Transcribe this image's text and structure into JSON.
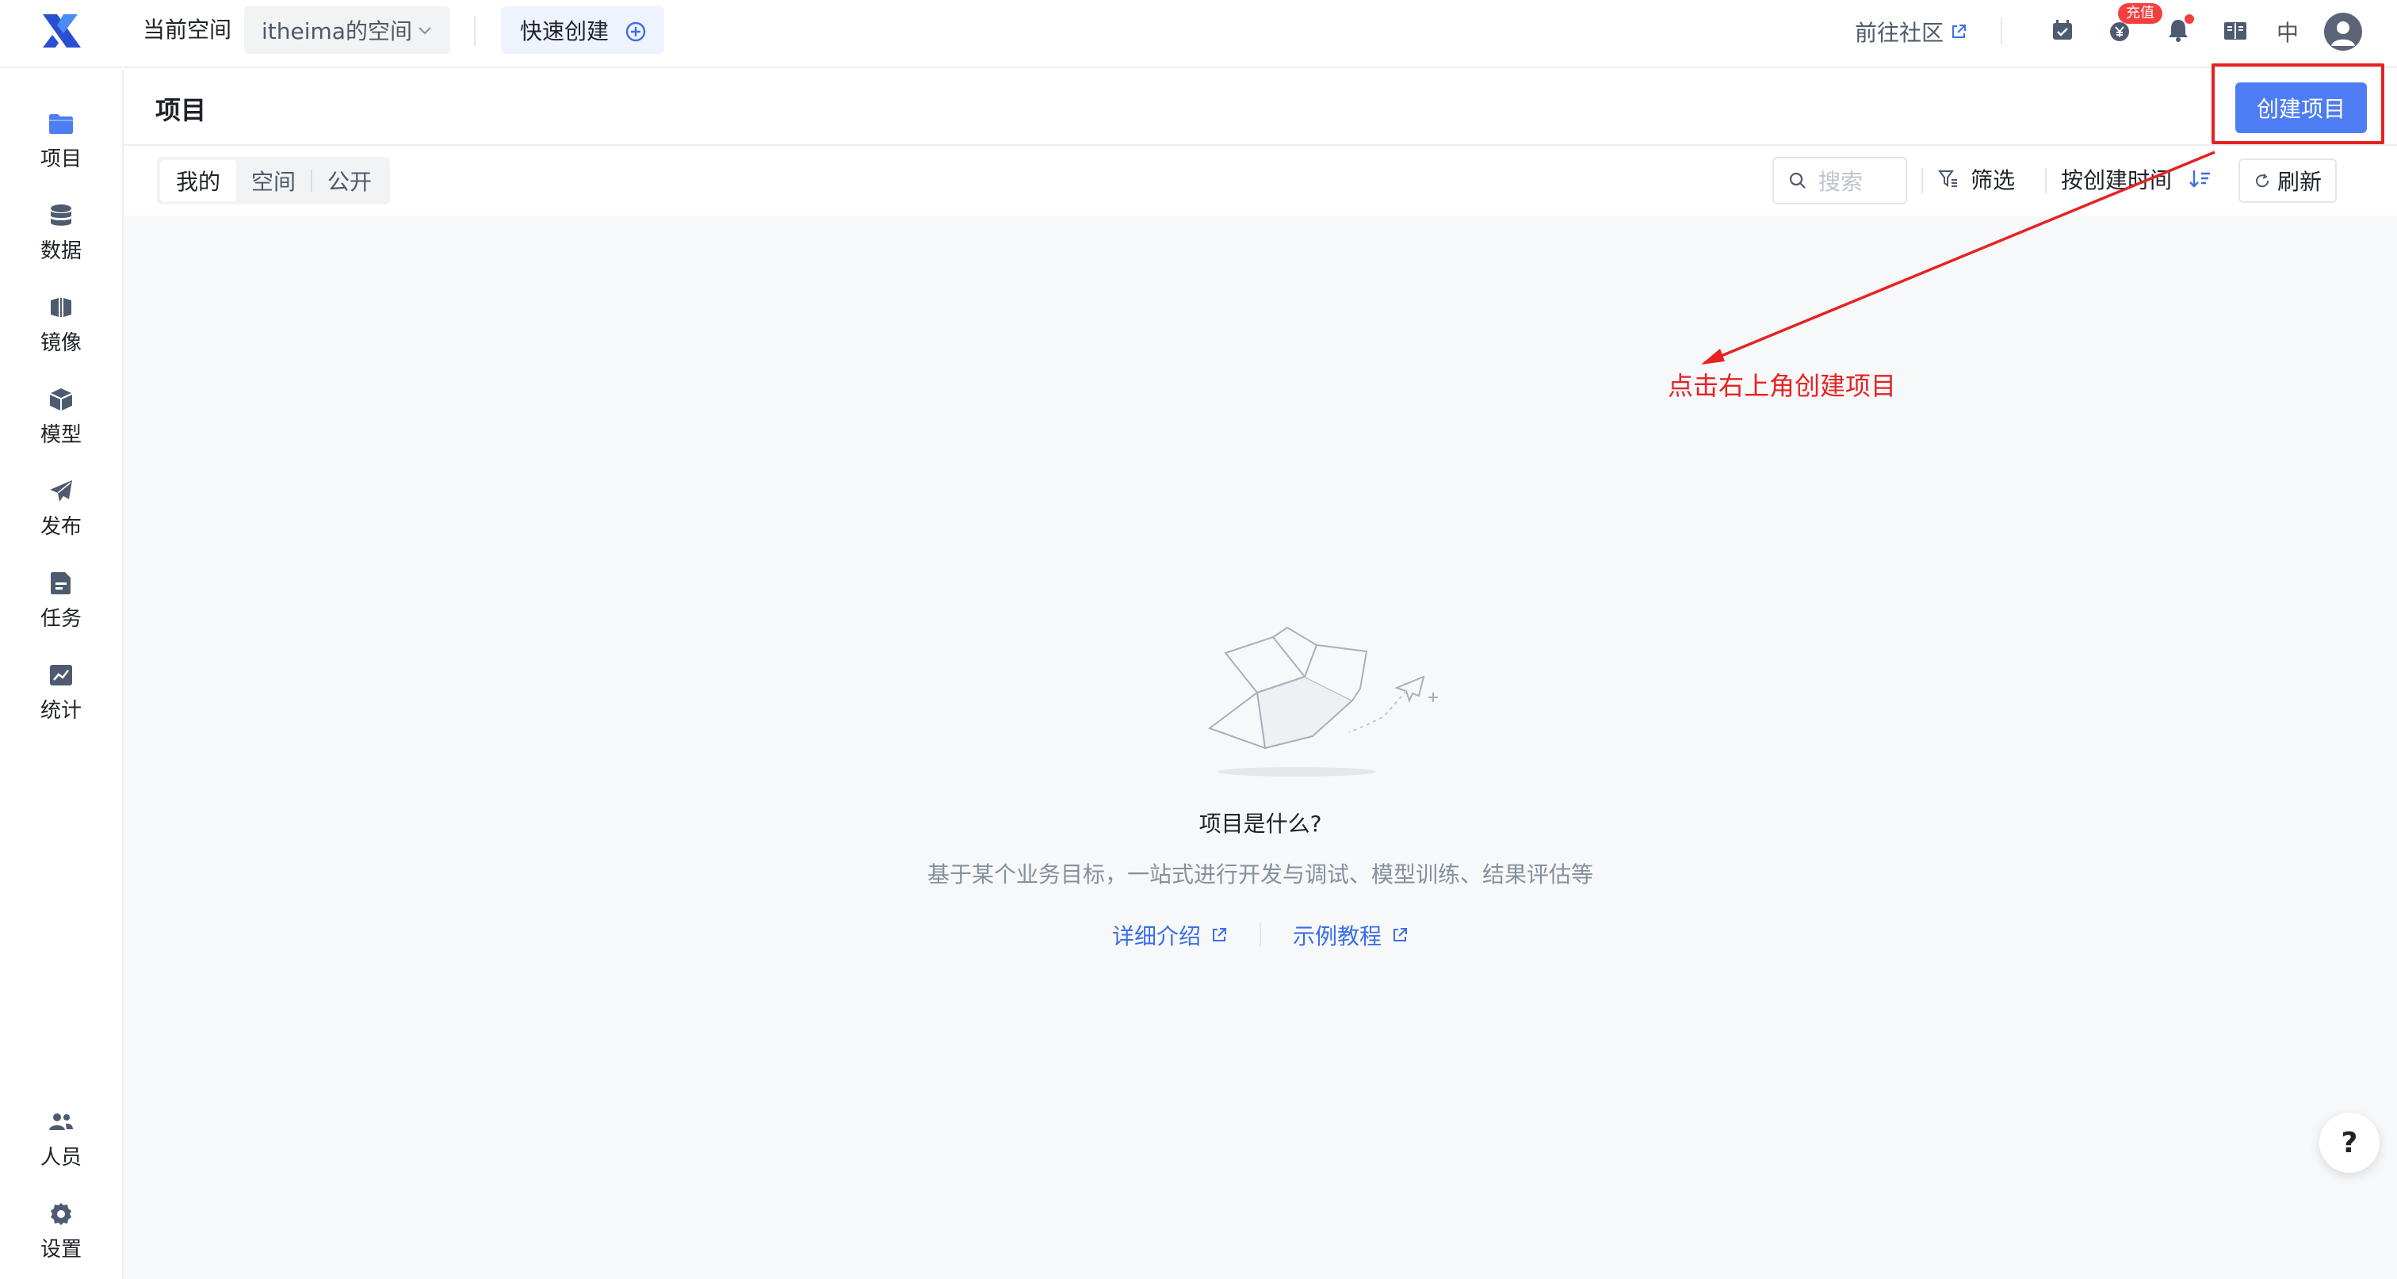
{
  "topbar": {
    "space_label": "当前空间",
    "space_value": "itheima的空间",
    "quick_create": "快速创建",
    "community": "前往社区",
    "recharge_badge": "充值",
    "lang": "中"
  },
  "sidebar": {
    "items": [
      {
        "label": "项目",
        "icon": "folder-icon"
      },
      {
        "label": "数据",
        "icon": "database-icon"
      },
      {
        "label": "镜像",
        "icon": "mirror-icon"
      },
      {
        "label": "模型",
        "icon": "cube-icon"
      },
      {
        "label": "发布",
        "icon": "send-icon"
      },
      {
        "label": "任务",
        "icon": "task-icon"
      },
      {
        "label": "统计",
        "icon": "chart-icon"
      }
    ],
    "bottom": [
      {
        "label": "人员",
        "icon": "people-icon"
      },
      {
        "label": "设置",
        "icon": "gear-icon"
      }
    ]
  },
  "page": {
    "title": "项目",
    "create_button": "创建项目"
  },
  "toolbar": {
    "tabs": [
      "我的",
      "空间",
      "公开"
    ],
    "active_tab": "我的",
    "search_placeholder": "搜索",
    "filter": "筛选",
    "sort": "按创建时间",
    "refresh": "刷新"
  },
  "empty": {
    "title": "项目是什么?",
    "description": "基于某个业务目标，一站式进行开发与调试、模型训练、结果评估等",
    "links": [
      "详细介绍",
      "示例教程"
    ]
  },
  "annotation": {
    "text": "点击右上角创建项目",
    "color": "#e62222"
  },
  "help": "?",
  "colors": {
    "primary": "#4e7cf2",
    "link": "#3b6ee6",
    "icon": "#4e5a70",
    "folder_active": "#4e7cf2"
  }
}
